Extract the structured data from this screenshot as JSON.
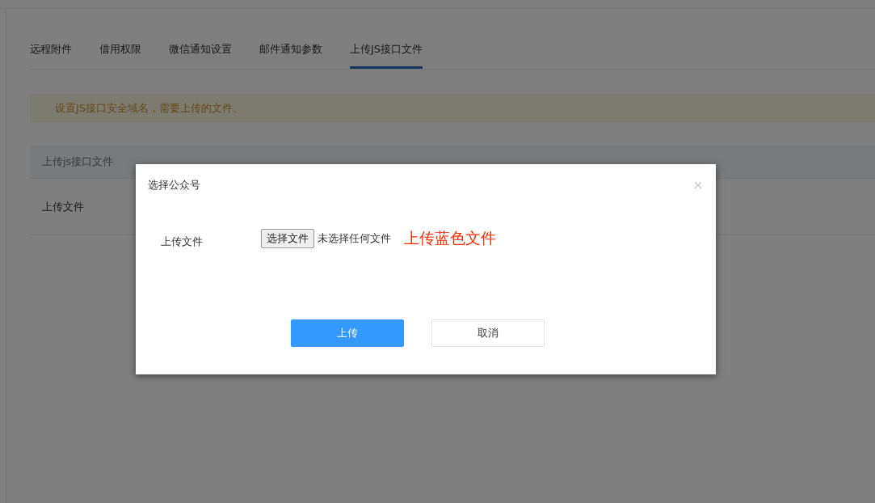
{
  "tabs": [
    {
      "label": "远程附件",
      "selected": false
    },
    {
      "label": "借用权限",
      "selected": false
    },
    {
      "label": "微信通知设置",
      "selected": false
    },
    {
      "label": "邮件通知参数",
      "selected": false
    },
    {
      "label": "上传JS接口文件",
      "selected": true
    }
  ],
  "alert": "设置JS接口安全域名，需要上传的文件。",
  "table": {
    "header": "上传js接口文件",
    "rows": [
      {
        "label": "上传文件"
      }
    ]
  },
  "dialog": {
    "title": "选择公众号",
    "field_label": "上传文件",
    "file_button": "选择文件",
    "file_status": "未选择任何文件",
    "note": "上传蓝色文件",
    "buttons": [
      {
        "label": "上传",
        "kind": "primary"
      },
      {
        "label": "取消",
        "kind": "default"
      }
    ]
  }
}
